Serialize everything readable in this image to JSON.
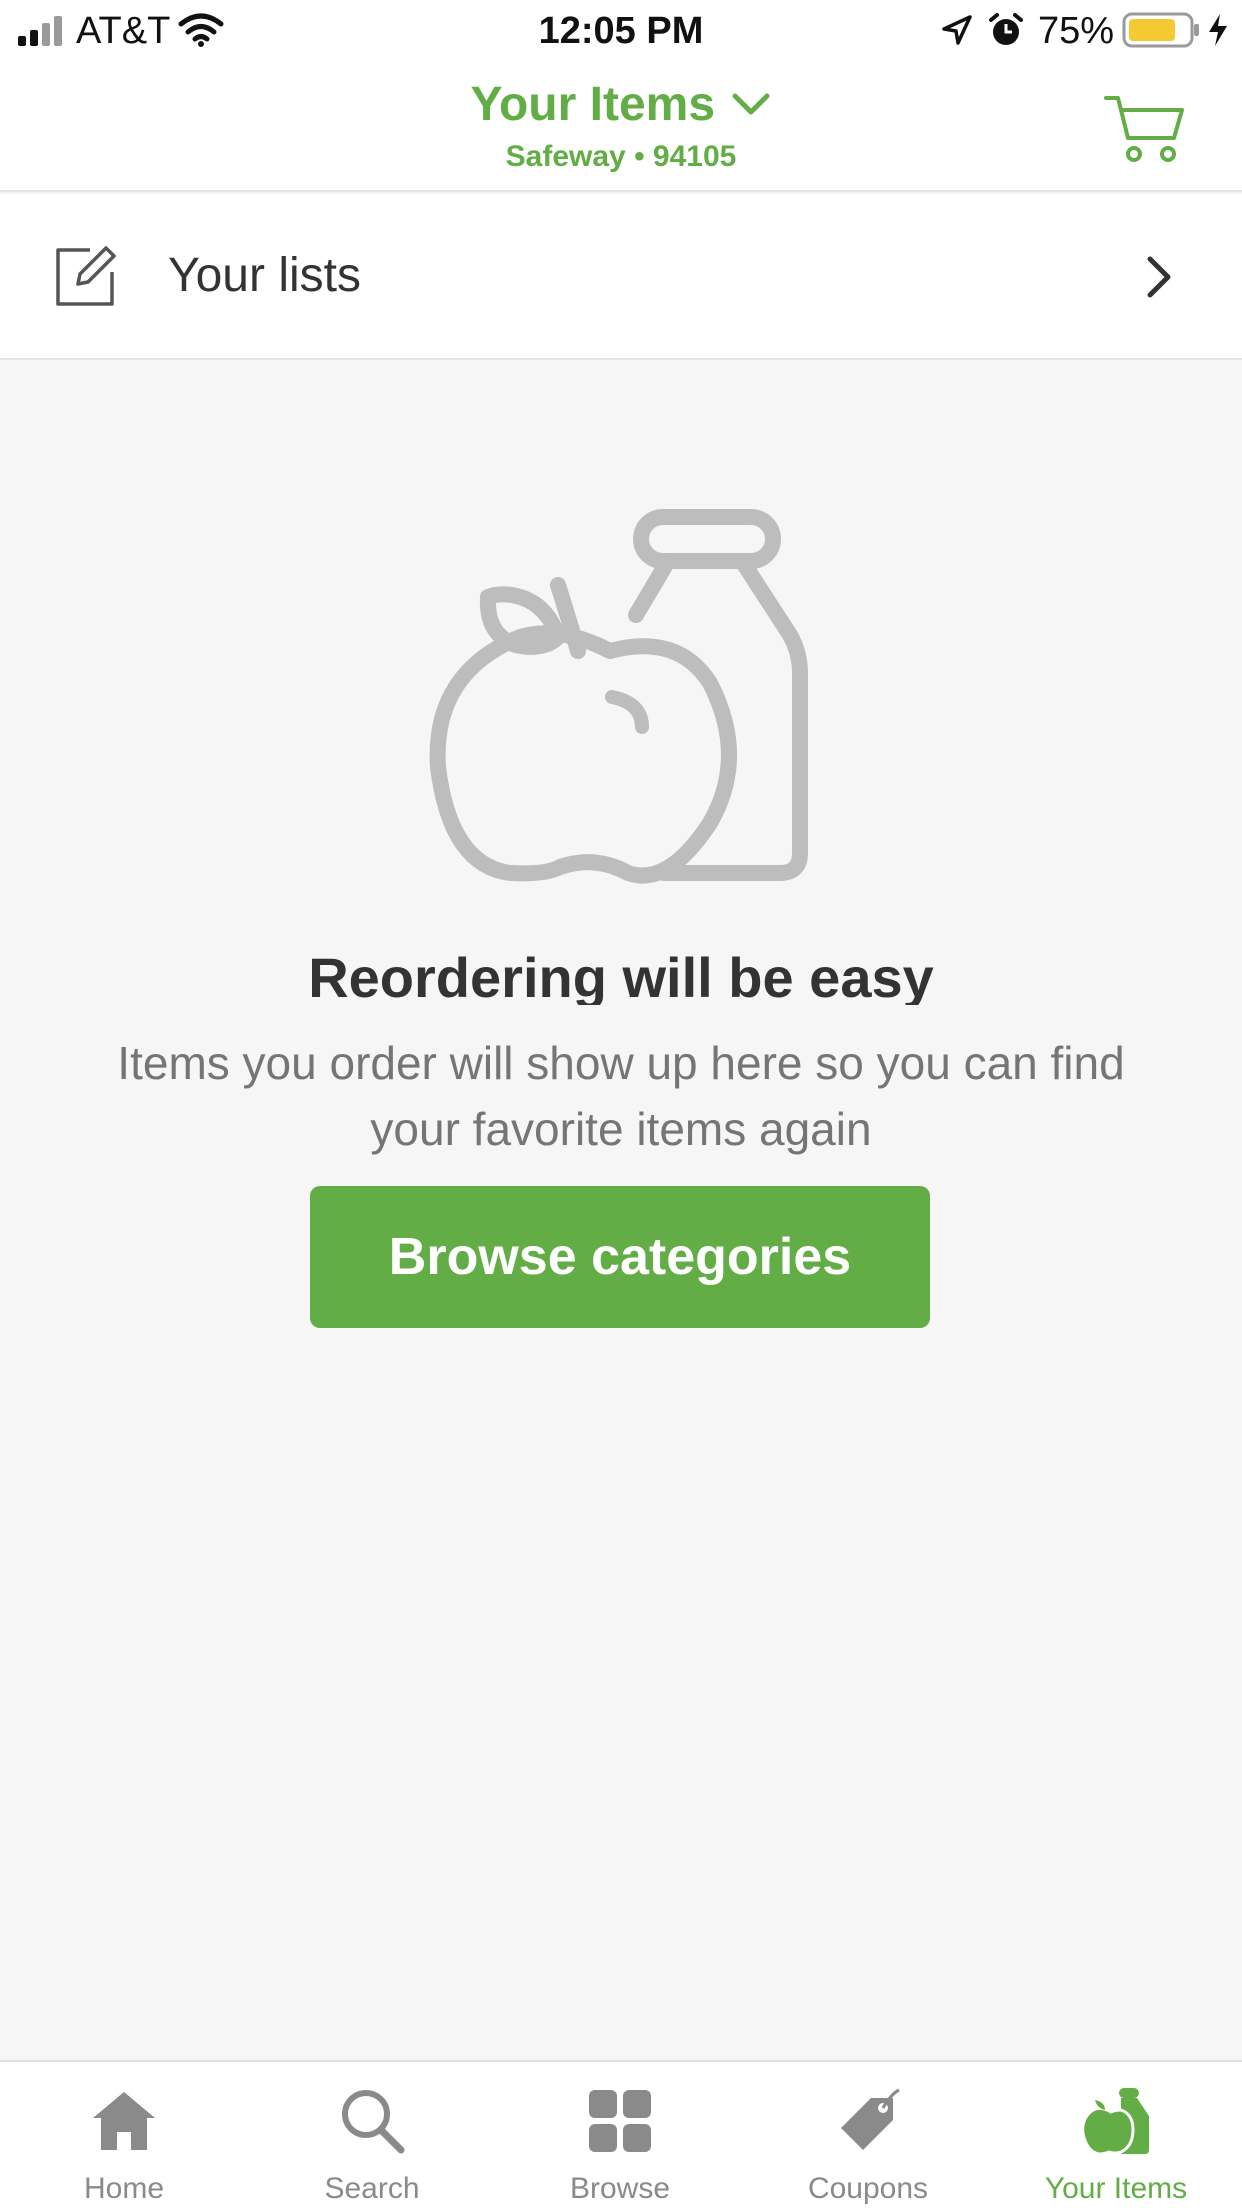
{
  "status_bar": {
    "carrier": "AT&T",
    "time": "12:05 PM",
    "battery": "75%",
    "icons": [
      "signal-icon",
      "wifi-icon",
      "location-icon",
      "alarm-icon",
      "battery-icon",
      "charging-icon"
    ]
  },
  "header": {
    "title": "Your Items",
    "subtitle": "Safeway • 94105",
    "icons": [
      "chevron-down-icon",
      "cart-icon"
    ]
  },
  "lists_row": {
    "label": "Your lists",
    "icons": [
      "edit-icon",
      "chevron-right-icon"
    ]
  },
  "empty_state": {
    "illustration": "apple-bottle-icon",
    "title": "Reordering will be easy",
    "description": "Items you order will show up here so you can find your favorite items again",
    "button_label": "Browse categories"
  },
  "tabs": [
    {
      "label": "Home",
      "icon": "home-icon",
      "active": false
    },
    {
      "label": "Search",
      "icon": "search-icon",
      "active": false
    },
    {
      "label": "Browse",
      "icon": "grid-icon",
      "active": false
    },
    {
      "label": "Coupons",
      "icon": "tag-icon",
      "active": false
    },
    {
      "label": "Your Items",
      "icon": "apple-bottle-icon",
      "active": true
    }
  ],
  "colors": {
    "accent": "#62ad45",
    "background": "#f6f6f6",
    "icon_gray": "#bdbdbd",
    "tab_gray": "#8a8a8a"
  }
}
